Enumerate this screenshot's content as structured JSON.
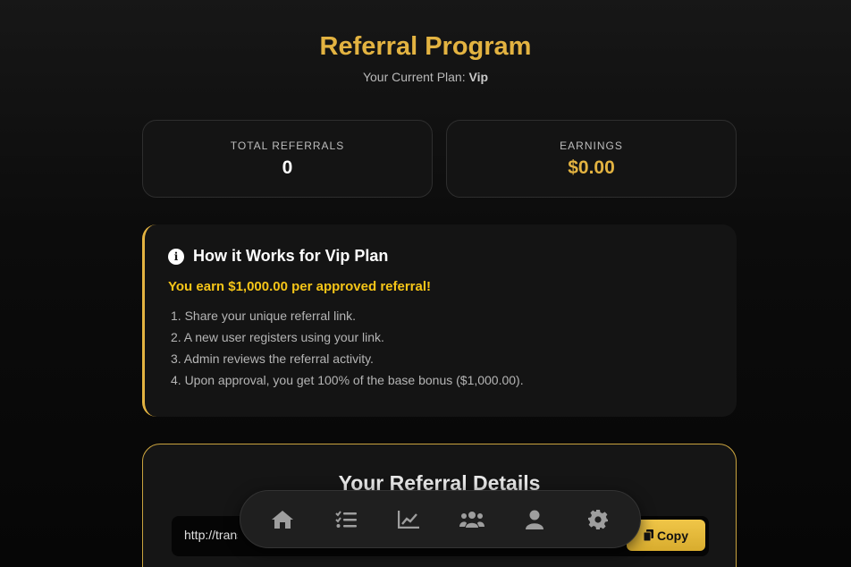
{
  "header": {
    "title": "Referral Program",
    "plan_prefix": "Your Current Plan:",
    "plan_name": "Vip"
  },
  "stats": {
    "referrals_label": "TOTAL REFERRALS",
    "referrals_value": "0",
    "earnings_label": "EARNINGS",
    "earnings_value": "$0.00"
  },
  "how_it_works": {
    "icon": "info-icon",
    "title": "How it Works for Vip Plan",
    "earn_text": "You earn $1,000.00 per approved referral!",
    "steps": [
      "1. Share your unique referral link.",
      "2. A new user registers using your link.",
      "3. Admin reviews the referral activity.",
      "4. Upon approval, you get 100% of the base bonus ($1,000.00)."
    ]
  },
  "referral_details": {
    "title": "Your Referral Details",
    "link_text": "http://trans",
    "copy_label": "Copy"
  },
  "bottom_nav": {
    "items": [
      "home-icon",
      "tasks-icon",
      "chart-icon",
      "users-icon",
      "user-icon",
      "gear-icon"
    ]
  },
  "colors": {
    "accent": "#e3b341",
    "earn_highlight": "#f5c518",
    "card_bg": "#141414"
  }
}
